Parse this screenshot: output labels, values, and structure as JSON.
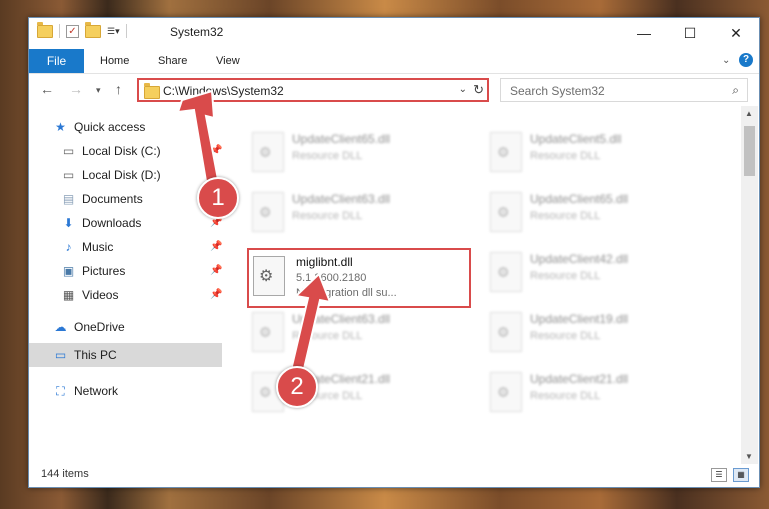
{
  "window": {
    "title": "System32"
  },
  "ribbon": {
    "file": "File",
    "tabs": [
      "Home",
      "Share",
      "View"
    ]
  },
  "address": {
    "path": "C:\\Windows\\System32"
  },
  "search": {
    "placeholder": "Search System32"
  },
  "sidebar": {
    "items": [
      {
        "label": "Quick access",
        "icon": "star-icon"
      },
      {
        "label": "Local Disk (C:)",
        "icon": "drive-icon"
      },
      {
        "label": "Local Disk (D:)",
        "icon": "drive-icon"
      },
      {
        "label": "Documents",
        "icon": "documents-icon"
      },
      {
        "label": "Downloads",
        "icon": "download-icon"
      },
      {
        "label": "Music",
        "icon": "music-icon"
      },
      {
        "label": "Pictures",
        "icon": "pictures-icon"
      },
      {
        "label": "Videos",
        "icon": "videos-icon"
      },
      {
        "label": "OneDrive",
        "icon": "cloud-icon"
      },
      {
        "label": "This PC",
        "icon": "computer-icon"
      },
      {
        "label": "Network",
        "icon": "network-icon"
      }
    ]
  },
  "files": [
    {
      "name": "UpdateClient65.dll",
      "desc": "Resource DLL"
    },
    {
      "name": "UpdateClient5.dll",
      "desc": "Resource DLL"
    },
    {
      "name": "UpdateClient63.dll",
      "desc": "Resource DLL"
    },
    {
      "name": "UpdateClient65.dll",
      "desc": "Resource DLL"
    },
    {
      "name": "UpdateClient42.dll",
      "desc": "Resource DLL"
    },
    {
      "name": "UpdateClient63.dll",
      "desc": "Resource DLL"
    },
    {
      "name": "UpdateClient19.dll",
      "desc": "Resource DLL"
    },
    {
      "name": "UpdateClient21.dll",
      "desc": "Resource DLL"
    },
    {
      "name": "UpdateClient21.dll",
      "desc": "Resource DLL"
    }
  ],
  "focused_file": {
    "name": "miglibnt.dll",
    "version": "5.1.2600.2180",
    "description": "NT migration dll su..."
  },
  "status": {
    "count": "144 items"
  },
  "badges": {
    "one": "1",
    "two": "2"
  },
  "colors": {
    "accent": "#1979ca",
    "highlight": "#d94b4b"
  }
}
